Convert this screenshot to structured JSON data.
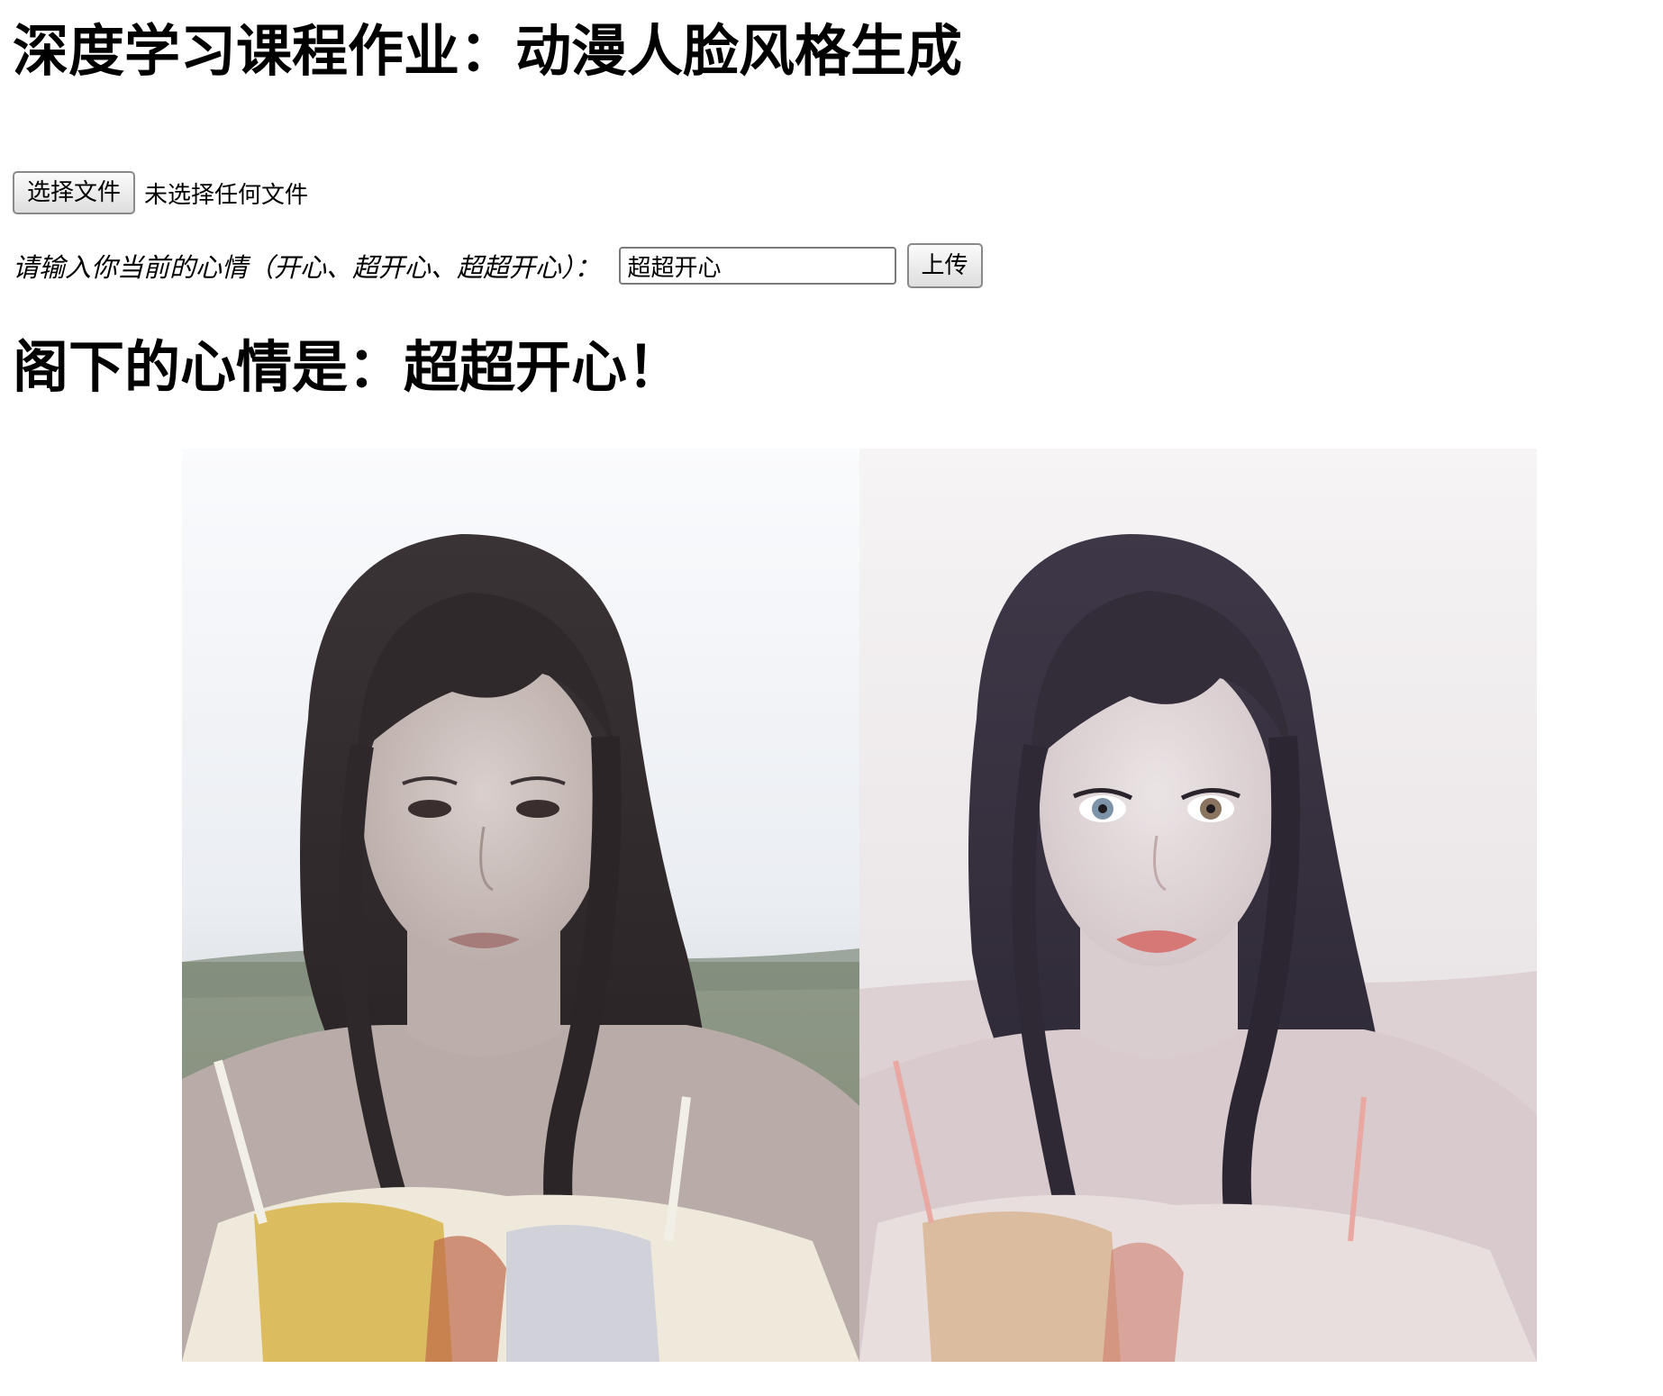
{
  "page_title": "深度学习课程作业：动漫人脸风格生成",
  "file_input": {
    "button_label": "选择文件",
    "status_text": "未选择任何文件"
  },
  "mood_form": {
    "label": "请输入你当前的心情（开心、超开心、超超开心）：",
    "input_value": "超超开心",
    "submit_label": "上传"
  },
  "result_text": "阁下的心情是：超超开心！",
  "images": {
    "original": {
      "icon": "photo-portrait"
    },
    "generated": {
      "icon": "anime-portrait"
    }
  }
}
